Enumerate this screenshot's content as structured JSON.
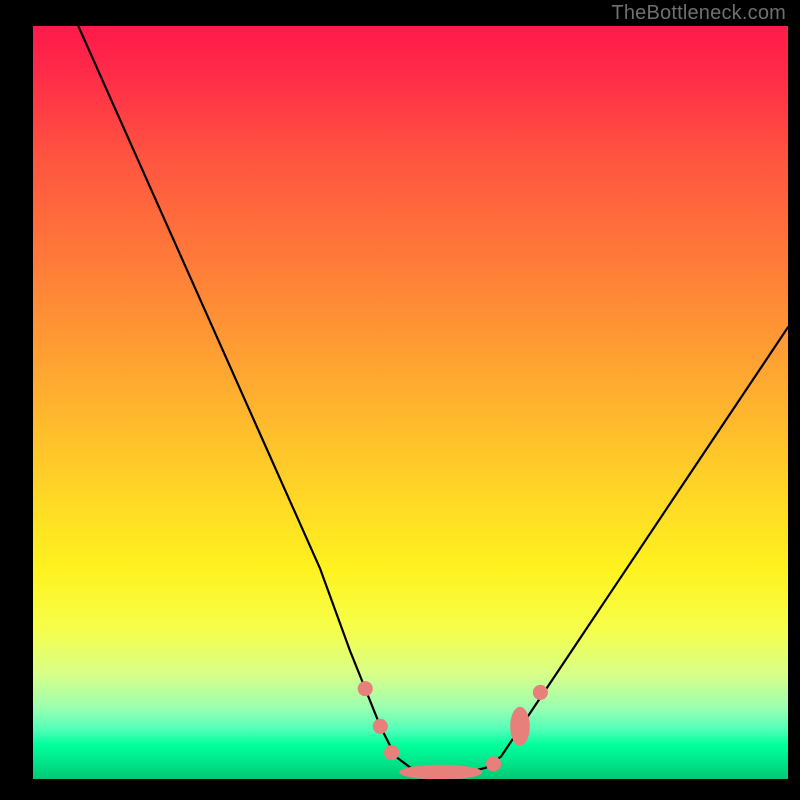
{
  "watermark": "TheBottleneck.com",
  "colors": {
    "bg_black": "#000000",
    "curve": "#000000",
    "marker_fill": "#e77f7a",
    "gradient_stops": [
      {
        "offset": 0.0,
        "color": "#ff1a4c"
      },
      {
        "offset": 0.06,
        "color": "#ff2a48"
      },
      {
        "offset": 0.18,
        "color": "#ff5640"
      },
      {
        "offset": 0.32,
        "color": "#ff7d39"
      },
      {
        "offset": 0.46,
        "color": "#ffa631"
      },
      {
        "offset": 0.6,
        "color": "#ffd028"
      },
      {
        "offset": 0.72,
        "color": "#fff21f"
      },
      {
        "offset": 0.8,
        "color": "#f6ff4a"
      },
      {
        "offset": 0.86,
        "color": "#d8ff88"
      },
      {
        "offset": 0.905,
        "color": "#9cffb0"
      },
      {
        "offset": 0.935,
        "color": "#4fffb8"
      },
      {
        "offset": 0.955,
        "color": "#00ff9c"
      },
      {
        "offset": 0.975,
        "color": "#00e88c"
      },
      {
        "offset": 1.0,
        "color": "#00c974"
      }
    ]
  },
  "layout": {
    "inner_x": 33,
    "inner_y": 26,
    "inner_w": 755,
    "inner_h": 753
  },
  "chart_data": {
    "type": "line",
    "title": "",
    "xlabel": "",
    "ylabel": "",
    "xlim": [
      0,
      100
    ],
    "ylim": [
      0,
      100
    ],
    "notes": "Bottleneck-style V-curve on a red→green vertical heat gradient. Axes are unlabeled; values are approximate normalized percentages (0 at left/bottom, 100 at right/top). Minimum (≈0% bottleneck) occurs in a flat trough around x≈48–60.",
    "series": [
      {
        "name": "curve",
        "x": [
          6,
          10,
          14,
          18,
          22,
          26,
          30,
          34,
          38,
          42,
          44,
          46,
          48,
          50,
          52,
          54,
          56,
          58,
          60,
          62,
          66,
          72,
          78,
          84,
          90,
          96,
          100
        ],
        "y": [
          100,
          91,
          82,
          73,
          64,
          55,
          46,
          37,
          28,
          17,
          12,
          7,
          3,
          1.5,
          1,
          0.8,
          0.8,
          1,
          1.5,
          3,
          9,
          18,
          27,
          36,
          45,
          54,
          60
        ]
      }
    ],
    "markers": [
      {
        "name": "dot",
        "x": 44.0,
        "y": 12.0,
        "rx": 1.0,
        "ry": 1.0
      },
      {
        "name": "dot",
        "x": 46.0,
        "y": 7.0,
        "rx": 1.0,
        "ry": 1.0
      },
      {
        "name": "dot",
        "x": 47.5,
        "y": 3.5,
        "rx": 1.0,
        "ry": 1.0
      },
      {
        "name": "pill",
        "x": 54.0,
        "y": 0.9,
        "rx": 5.5,
        "ry": 1.0
      },
      {
        "name": "dot",
        "x": 61.0,
        "y": 2.0,
        "rx": 1.0,
        "ry": 1.0
      },
      {
        "name": "pill",
        "x": 64.5,
        "y": 7.0,
        "rx": 1.3,
        "ry": 2.6
      },
      {
        "name": "dot",
        "x": 67.2,
        "y": 11.5,
        "rx": 1.0,
        "ry": 1.0
      }
    ]
  }
}
